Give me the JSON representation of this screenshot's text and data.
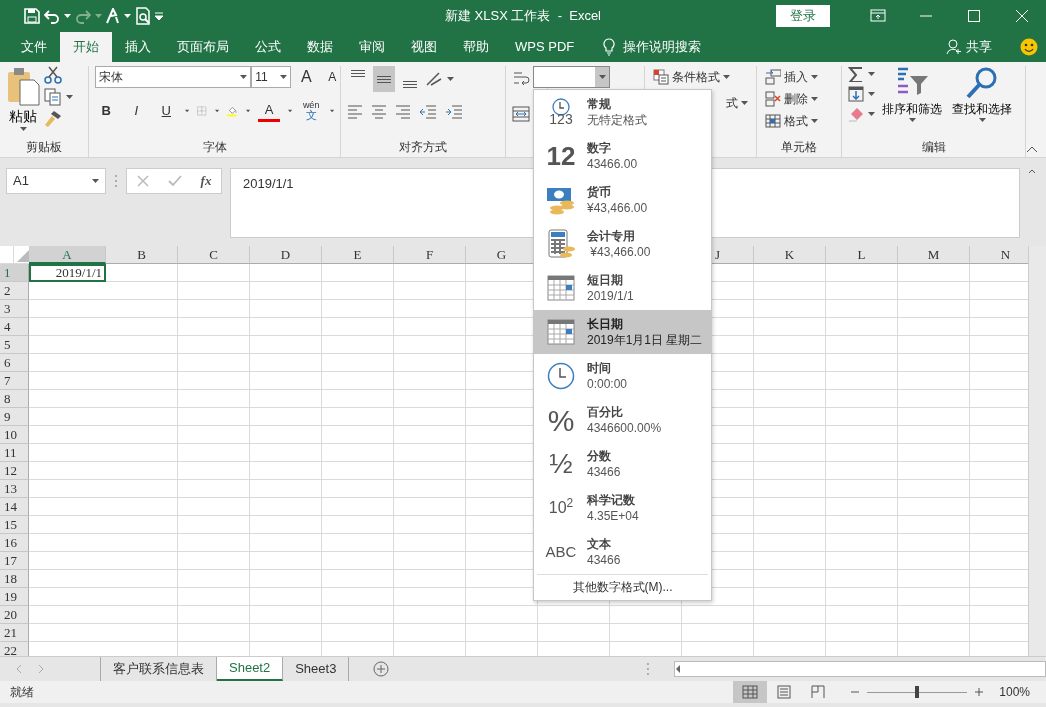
{
  "title_bar": {
    "title": "新建 XLSX 工作表  -  Excel",
    "login_button": "登录"
  },
  "tabs": [
    {
      "label": "文件",
      "selected": false
    },
    {
      "label": "开始",
      "selected": true
    },
    {
      "label": "插入",
      "selected": false
    },
    {
      "label": "页面布局",
      "selected": false
    },
    {
      "label": "公式",
      "selected": false
    },
    {
      "label": "数据",
      "selected": false
    },
    {
      "label": "审阅",
      "selected": false
    },
    {
      "label": "视图",
      "selected": false
    },
    {
      "label": "帮助",
      "selected": false
    },
    {
      "label": "WPS PDF",
      "selected": false
    }
  ],
  "tell_me": "操作说明搜索",
  "share": "共享",
  "ribbon": {
    "clipboard": {
      "paste": "粘贴",
      "label": "剪贴板"
    },
    "font": {
      "name": "宋体",
      "size": "11",
      "grow": "A",
      "shrink": "A",
      "bold": "B",
      "italic": "I",
      "underline": "U",
      "color_letter": "A",
      "phonetic_top": "wén",
      "phonetic_bottom": "文",
      "label": "字体"
    },
    "alignment": {
      "vertical_align": [
        {
          "selected": false
        },
        {
          "selected": true
        },
        {
          "selected": false
        }
      ],
      "label": "对齐方式"
    },
    "styles": {
      "conditional": "条件格式",
      "table_format_partial": "式"
    },
    "cells": {
      "insert": "插入",
      "delete": "删除",
      "format": "格式",
      "label": "单元格"
    },
    "editing": {
      "sort": "排序和筛选",
      "find": "查找和选择",
      "label": "编辑"
    }
  },
  "formula_bar": {
    "name_box": "A1",
    "fx": "fx",
    "formula": "2019/1/1"
  },
  "grid": {
    "columns_left": [
      {
        "label": "A",
        "selected": true
      },
      {
        "label": "B",
        "selected": false
      },
      {
        "label": "C",
        "selected": false
      },
      {
        "label": "D",
        "selected": false
      },
      {
        "label": "E",
        "selected": false
      },
      {
        "label": "F",
        "selected": false
      },
      {
        "label": "G",
        "selected": false
      }
    ],
    "columns_right": [
      {
        "label": "J",
        "selected": false
      },
      {
        "label": "K",
        "selected": false
      },
      {
        "label": "L",
        "selected": false
      },
      {
        "label": "M",
        "selected": false
      },
      {
        "label": "N",
        "selected": false
      }
    ],
    "rows": [
      {
        "header": "1",
        "selected": true,
        "cells": [
          "2019/1/1"
        ]
      },
      {
        "header": "2",
        "selected": false
      },
      {
        "header": "3",
        "selected": false
      },
      {
        "header": "4",
        "selected": false
      },
      {
        "header": "5",
        "selected": false
      },
      {
        "header": "6",
        "selected": false
      },
      {
        "header": "7",
        "selected": false
      },
      {
        "header": "8",
        "selected": false
      },
      {
        "header": "9",
        "selected": false
      },
      {
        "header": "10",
        "selected": false
      },
      {
        "header": "11",
        "selected": false
      },
      {
        "header": "12",
        "selected": false
      },
      {
        "header": "13",
        "selected": false
      },
      {
        "header": "14",
        "selected": false
      },
      {
        "header": "15",
        "selected": false
      },
      {
        "header": "16",
        "selected": false
      },
      {
        "header": "17",
        "selected": false
      },
      {
        "header": "18",
        "selected": false
      },
      {
        "header": "19",
        "selected": false
      },
      {
        "header": "20",
        "selected": false
      },
      {
        "header": "21",
        "selected": false
      },
      {
        "header": "22",
        "selected": false
      }
    ]
  },
  "number_format_menu": {
    "items": [
      {
        "kind": "general",
        "icon_text": "123",
        "title": "常规",
        "example": "无特定格式",
        "selected": false
      },
      {
        "kind": "number",
        "icon_text": "12",
        "title": "数字",
        "example": "43466.00",
        "selected": false
      },
      {
        "kind": "currency",
        "title": "货币",
        "example": "¥43,466.00",
        "selected": false
      },
      {
        "kind": "accounting",
        "title": "会计专用",
        "example": " ¥43,466.00",
        "selected": false
      },
      {
        "kind": "date",
        "title": "短日期",
        "example": "2019/1/1",
        "selected": false
      },
      {
        "kind": "date",
        "title": "长日期",
        "example": "2019年1月1日 星期二",
        "selected": true
      },
      {
        "kind": "time",
        "title": "时间",
        "example": "0:00:00",
        "selected": false
      },
      {
        "kind": "percent",
        "icon_text": "%",
        "title": "百分比",
        "example": "4346600.00%",
        "selected": false
      },
      {
        "kind": "fraction",
        "icon_text": "½",
        "title": "分数",
        "example": "43466",
        "selected": false
      },
      {
        "kind": "scientific",
        "icon_text": "10$^{2}$",
        "title": "科学记数",
        "example": "4.35E+04",
        "selected": false
      },
      {
        "kind": "text",
        "icon_text": "ABC",
        "title": "文本",
        "example": "43466",
        "selected": false
      }
    ],
    "more": "其他数字格式(M)..."
  },
  "sheet_tabs": [
    {
      "label": "客户联系信息表",
      "selected": false
    },
    {
      "label": "Sheet2",
      "selected": true
    },
    {
      "label": "Sheet3",
      "selected": false
    }
  ],
  "status_bar": {
    "text": "就绪",
    "views": [
      {
        "kind": "normal",
        "selected": true
      },
      {
        "kind": "layout",
        "selected": false
      },
      {
        "kind": "break",
        "selected": false
      }
    ],
    "level": 0.5,
    "zoom": "100%"
  }
}
